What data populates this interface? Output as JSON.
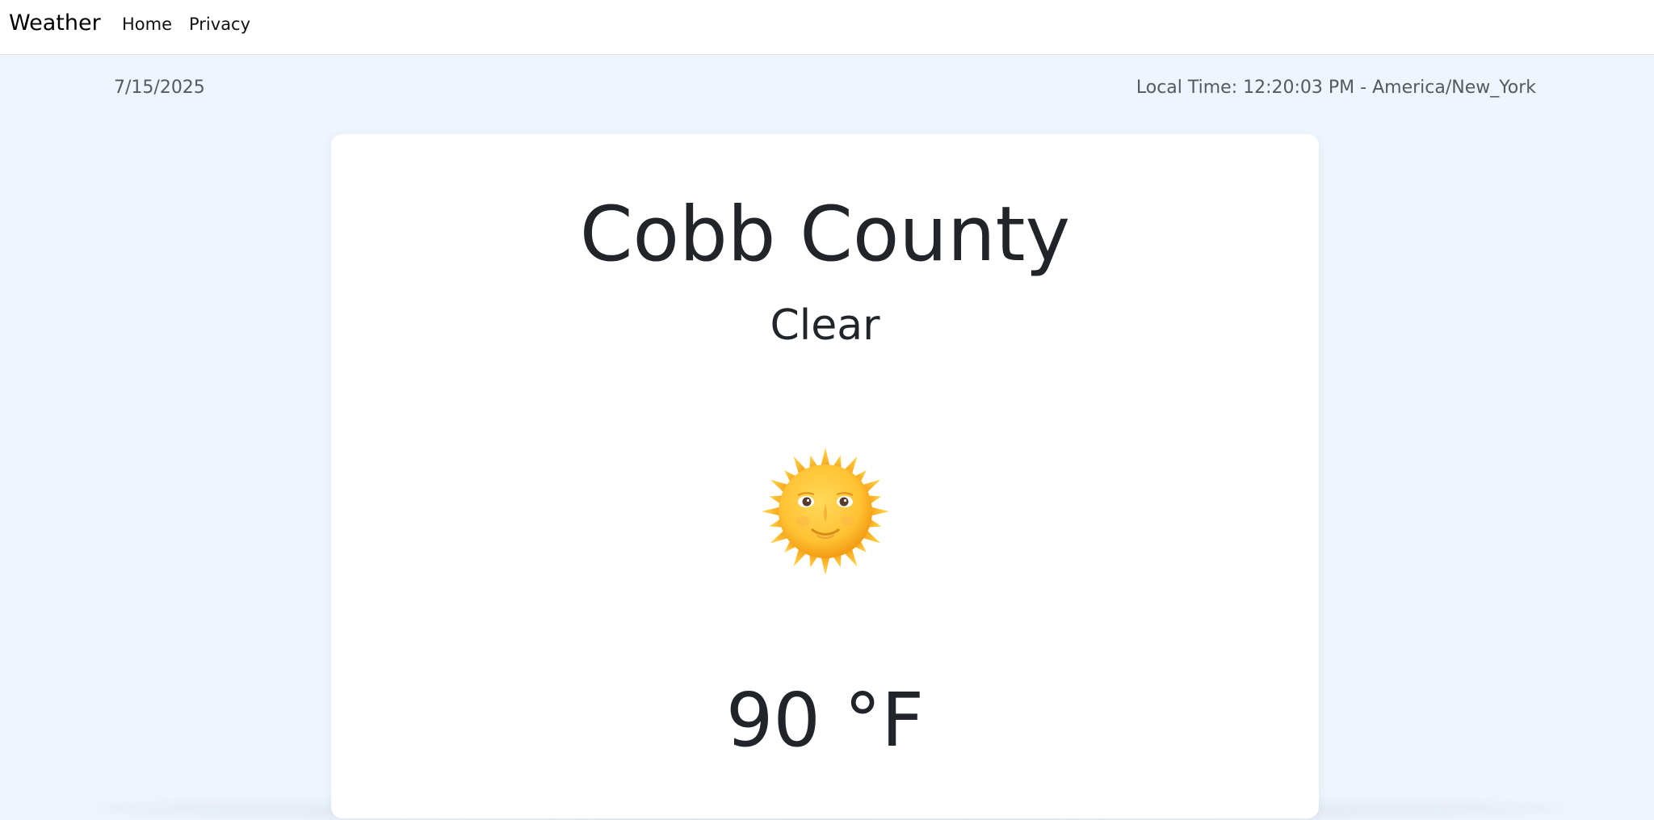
{
  "nav": {
    "brand": "Weather",
    "links": [
      {
        "label": "Home"
      },
      {
        "label": "Privacy"
      }
    ]
  },
  "info": {
    "date": "7/15/2025",
    "local_time": "Local Time: 12:20:03 PM - America/New_York"
  },
  "weather": {
    "location": "Cobb County",
    "condition": "Clear",
    "icon": "sun-with-face-icon",
    "temperature": "90 °F"
  },
  "colors": {
    "page_background": "#eef5fd",
    "card_background": "#ffffff",
    "text": "#212529",
    "muted_text": "#555a60",
    "sun_yellow": "#ffc83d",
    "sun_orange": "#f7a21b"
  }
}
